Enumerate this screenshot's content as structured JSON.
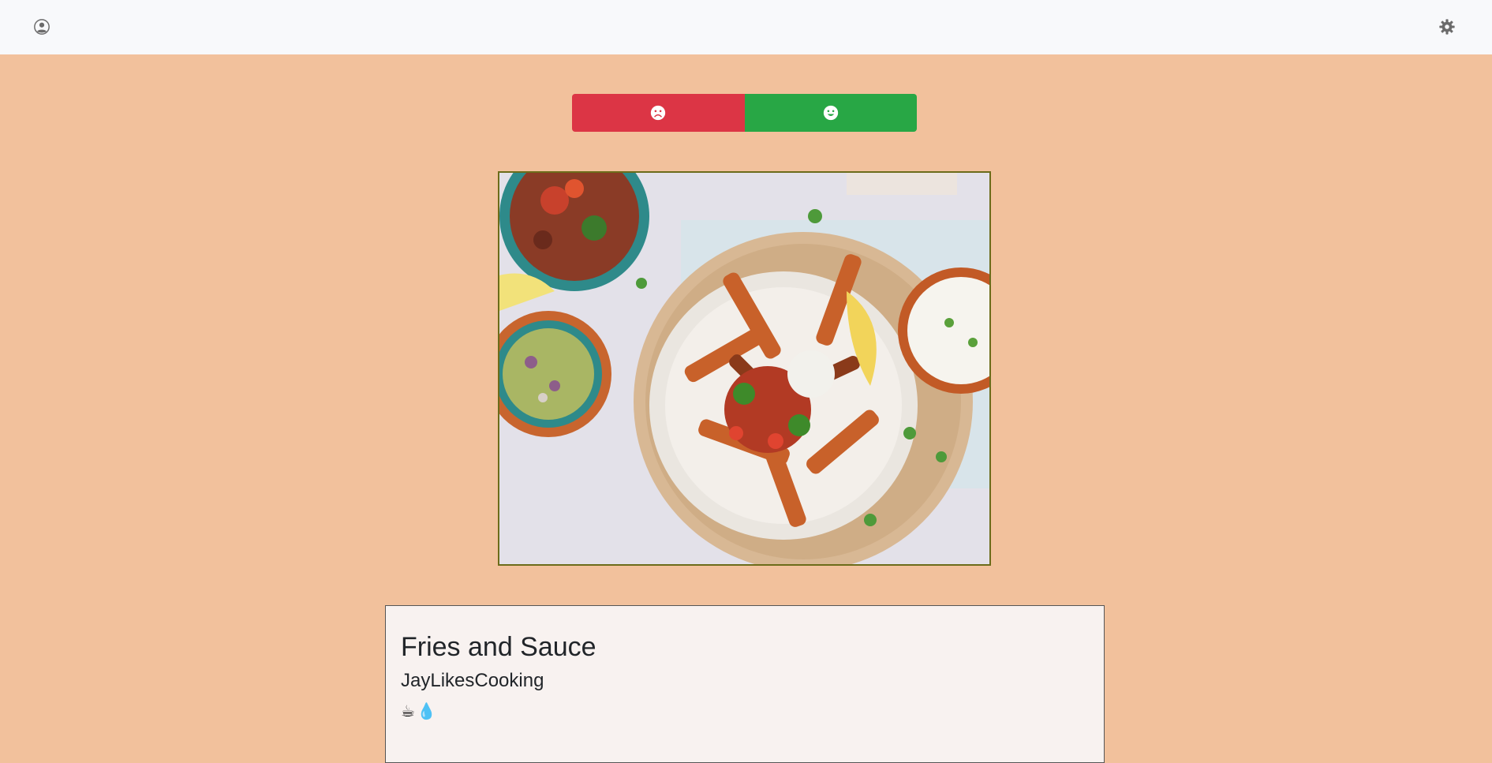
{
  "header": {
    "profile_icon": "user-circle-icon",
    "settings_icon": "gear-icon"
  },
  "vote": {
    "dislike_icon": "frown-icon",
    "like_icon": "smile-icon",
    "colors": {
      "dislike": "#dc3545",
      "like": "#28a745"
    }
  },
  "recipe": {
    "image_alt_icon": "food-photo",
    "title": "Fries and Sauce",
    "author": "JayLikesCooking",
    "tags": [
      "☕",
      "💧"
    ]
  },
  "colors": {
    "page_background": "#f2c19c",
    "topbar_background": "#f8f9fb",
    "card_background": "#f8f2f0"
  }
}
